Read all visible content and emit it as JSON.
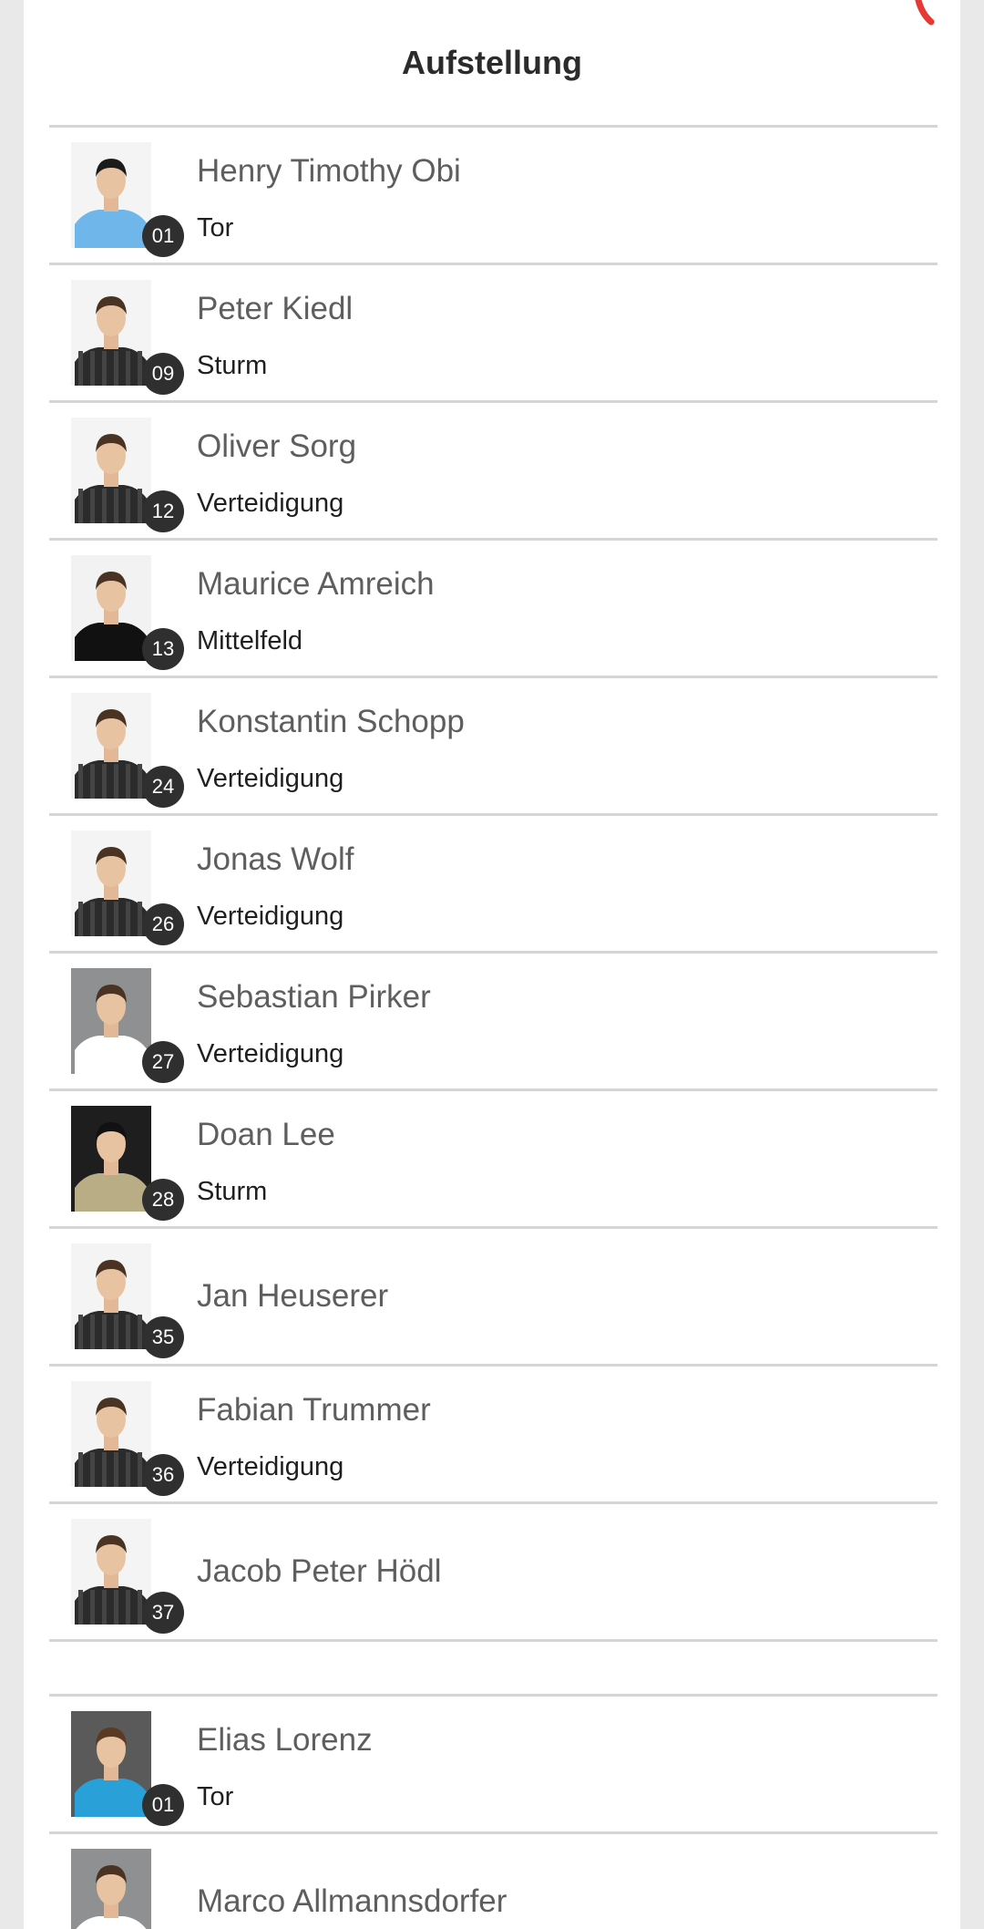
{
  "title": "Aufstellung",
  "colors": {
    "accent_red": "#e53935",
    "badge_bg": "#2f2f2f",
    "divider": "#d5d5d5"
  },
  "lineup": [
    {
      "name": "Henry Timothy Obi",
      "number": "01",
      "position": "Tor",
      "kit": "keeper-blue"
    },
    {
      "name": "Peter Kiedl",
      "number": "09",
      "position": "Sturm",
      "kit": "striped-dark"
    },
    {
      "name": "Oliver Sorg",
      "number": "12",
      "position": "Verteidigung",
      "kit": "striped-dark"
    },
    {
      "name": "Maurice Amreich",
      "number": "13",
      "position": "Mittelfeld",
      "kit": "black-shirt"
    },
    {
      "name": "Konstantin Schopp",
      "number": "24",
      "position": "Verteidigung",
      "kit": "striped-dark"
    },
    {
      "name": "Jonas Wolf",
      "number": "26",
      "position": "Verteidigung",
      "kit": "striped-dark"
    },
    {
      "name": "Sebastian Pirker",
      "number": "27",
      "position": "Verteidigung",
      "kit": "white-shirt"
    },
    {
      "name": "Doan Lee",
      "number": "28",
      "position": "Sturm",
      "kit": "khaki-shirt"
    },
    {
      "name": "Jan Heuserer",
      "number": "35",
      "position": "",
      "kit": "striped-dark"
    },
    {
      "name": "Fabian Trummer",
      "number": "36",
      "position": "Verteidigung",
      "kit": "striped-dark"
    },
    {
      "name": "Jacob Peter Hödl",
      "number": "37",
      "position": "",
      "kit": "striped-dark"
    }
  ],
  "substitutes": [
    {
      "name": "Elias Lorenz",
      "number": "01",
      "position": "Tor",
      "kit": "keeper-blue-card"
    },
    {
      "name": "Marco Allmannsdorfer",
      "number": "",
      "position": "",
      "kit": "white-shirt"
    }
  ]
}
